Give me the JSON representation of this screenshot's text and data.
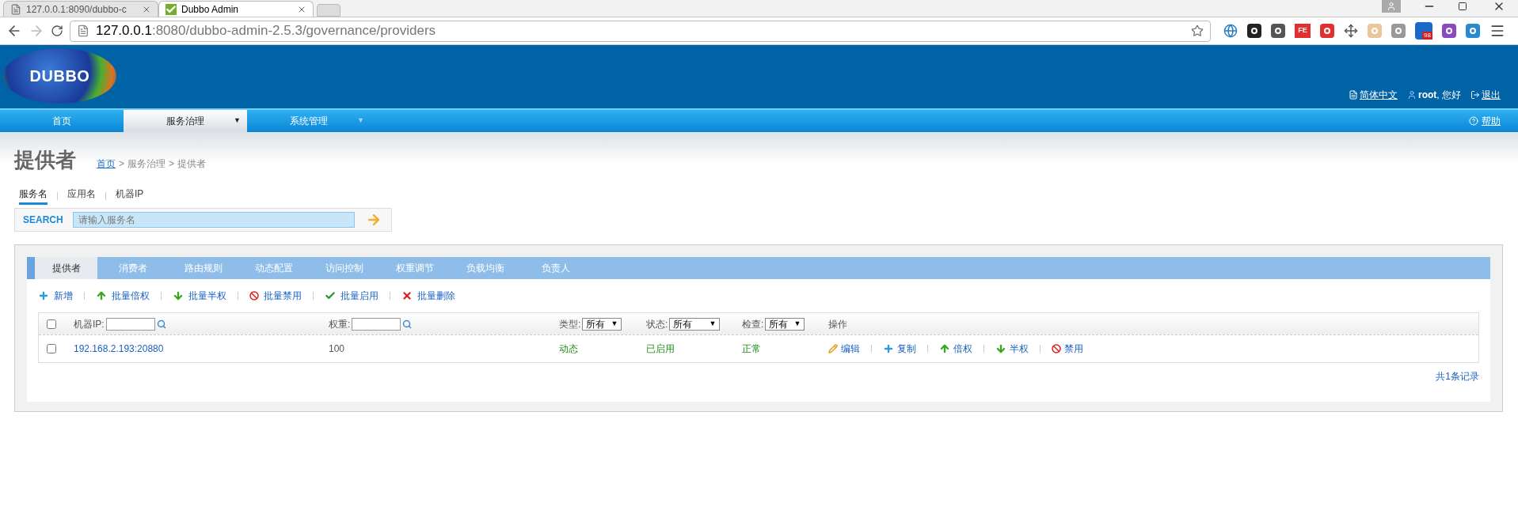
{
  "browser": {
    "tabs": [
      {
        "title": "127.0.0.1:8090/dubbo-c",
        "selected": false
      },
      {
        "title": "Dubbo Admin",
        "selected": true
      }
    ],
    "url": {
      "host": "127.0.0.1",
      "rest": ":8080/dubbo-admin-2.5.3/governance/providers"
    },
    "extension_label": "FE",
    "extension_badge": "98"
  },
  "header": {
    "logo": "DUBBO",
    "links": [
      {
        "kind": "language",
        "label": "简体中文"
      },
      {
        "kind": "user",
        "label": "root, 您好"
      },
      {
        "kind": "logout",
        "label": "退出"
      }
    ]
  },
  "nav": {
    "items": [
      {
        "label": "首页",
        "selected": false
      },
      {
        "label": "服务治理",
        "selected": true,
        "caret": "▼"
      },
      {
        "label": "系统管理",
        "selected": false,
        "caret": "▼"
      }
    ],
    "help": "帮助"
  },
  "page": {
    "title": "提供者",
    "breadcrumb": {
      "items": [
        "首页",
        "服务治理",
        "提供者"
      ],
      "separator": ">"
    }
  },
  "search": {
    "tabs": [
      {
        "label": "服务名",
        "selected": true
      },
      {
        "label": "应用名",
        "selected": false
      },
      {
        "label": "机器IP",
        "selected": false
      }
    ],
    "label": "SEARCH",
    "placeholder": "请输入服务名"
  },
  "tabs": [
    {
      "label": "提供者",
      "selected": true
    },
    {
      "label": "消费者",
      "selected": false
    },
    {
      "label": "路由规则",
      "selected": false
    },
    {
      "label": "动态配置",
      "selected": false
    },
    {
      "label": "访问控制",
      "selected": false
    },
    {
      "label": "权重调节",
      "selected": false
    },
    {
      "label": "负载均衡",
      "selected": false
    },
    {
      "label": "负责人",
      "selected": false
    }
  ],
  "toolbar": [
    {
      "kind": "add",
      "label": "新增"
    },
    {
      "kind": "up",
      "label": "批量倍权"
    },
    {
      "kind": "down",
      "label": "批量半权"
    },
    {
      "kind": "ban",
      "label": "批量禁用"
    },
    {
      "kind": "check",
      "label": "批量启用"
    },
    {
      "kind": "delete",
      "label": "批量删除"
    }
  ],
  "table": {
    "header_checked": false,
    "columns": [
      {
        "kind": "input",
        "label": "机器IP:"
      },
      {
        "kind": "input",
        "label": "权重:"
      },
      {
        "kind": "select",
        "label": "类型:",
        "value": "所有",
        "caret": "▼"
      },
      {
        "kind": "select",
        "label": "状态:",
        "value": "所有",
        "caret": "▼"
      },
      {
        "kind": "select",
        "label": "检查:",
        "value": "所有",
        "caret": "▼"
      },
      {
        "kind": "text",
        "label": "操作"
      }
    ],
    "rows": [
      {
        "checked": false,
        "address": "192.168.2.193:20880",
        "weight": "100",
        "type": "动态",
        "status": "已启用",
        "check": "正常",
        "actions": [
          {
            "kind": "edit",
            "label": "编辑"
          },
          {
            "kind": "add",
            "label": "复制"
          },
          {
            "kind": "up",
            "label": "倍权"
          },
          {
            "kind": "down",
            "label": "半权"
          },
          {
            "kind": "ban",
            "label": "禁用"
          }
        ]
      }
    ]
  },
  "footer": "共1条记录"
}
